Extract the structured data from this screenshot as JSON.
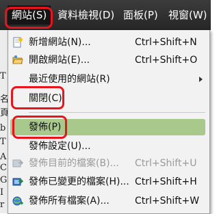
{
  "background_doc": {
    "fragments": [
      "名",
      "T",
      "頁",
      "b",
      "T",
      "A",
      "C",
      "G",
      "I",
      "r"
    ]
  },
  "menubar": {
    "items": [
      {
        "label": "網站(S)",
        "active": true
      },
      {
        "label": "資料檢視(D)"
      },
      {
        "label": "面板(P)"
      },
      {
        "label": "視窗(W)"
      }
    ]
  },
  "menu": {
    "items": [
      {
        "label": "新增網站(N)...",
        "shortcut": "Ctrl+Shift+N",
        "icon": "new-site-icon"
      },
      {
        "label": "開啟網站(E)...",
        "shortcut": "Ctrl+Shift+O",
        "icon": "open-folder-icon"
      },
      {
        "label": "最近使用的網站(R)",
        "submenu": true
      },
      {
        "label": "關閉(C)"
      },
      {
        "label": "發佈(P)",
        "selected": true
      },
      {
        "label": "發佈設定(U)..."
      },
      {
        "label": "發佈目前的檔案(B)...",
        "shortcut": "Ctrl+Shift+U",
        "icon": "publish-current-file-icon",
        "disabled": true
      },
      {
        "label": "發佈已變更的檔案(H)...",
        "shortcut": "Ctrl+Shift+H",
        "icon": "publish-changed-files-icon"
      },
      {
        "label": "發佈所有檔案(A)...",
        "shortcut": "Ctrl+Shift+W",
        "icon": "publish-all-files-icon"
      }
    ]
  },
  "colors": {
    "highlight_border": "#e8131b",
    "selected_bg": "#a9c98c",
    "menubar_bg": "#2e2e2e"
  }
}
